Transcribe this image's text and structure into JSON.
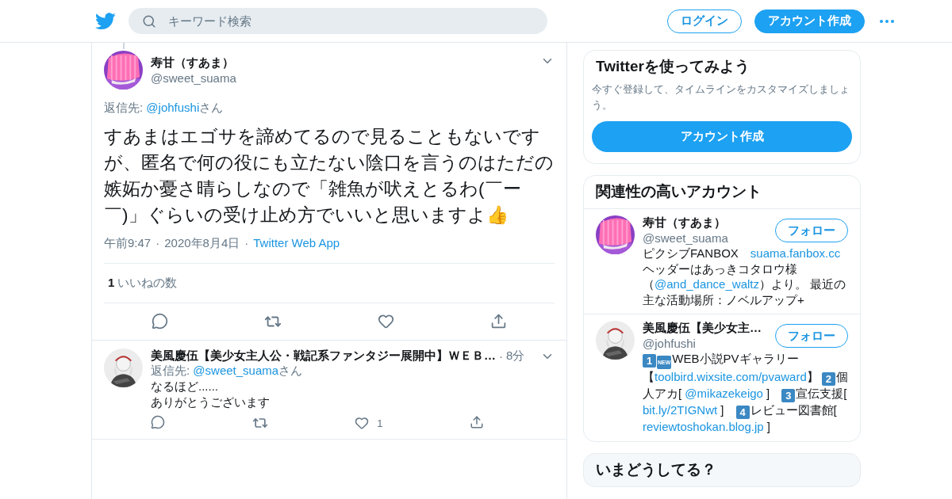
{
  "header": {
    "search": {
      "placeholder": "キーワード検索"
    },
    "login": "ログイン",
    "signup": "アカウント作成"
  },
  "tweet": {
    "name": "寿甘（すあま）",
    "handle": "@sweet_suama",
    "reply": [
      {
        "kind": "plain",
        "text": "返信先: "
      },
      {
        "kind": "link",
        "text": "@johfushi"
      },
      {
        "kind": "plain",
        "text": "さん"
      }
    ],
    "body": "すあまはエゴサを諦めてるので見ることもないですが、匿名で何の役にも立たない陰口を言うのはただの嫉妬か憂さ晴らしなので「雑魚が吠えとるわ(￣ー￣)」ぐらいの受け止め方でいいと思いますよ👍",
    "meta": [
      {
        "kind": "plain",
        "text": "午前9:47"
      },
      {
        "kind": "plain",
        "text": "·"
      },
      {
        "kind": "plain",
        "text": "2020年8月4日"
      },
      {
        "kind": "plain",
        "text": "·"
      },
      {
        "kind": "link",
        "text": "Twitter Web App"
      }
    ],
    "like_count": "1",
    "like_label": "いいねの数"
  },
  "replies": [
    {
      "name": "美風慶伍【美少女主人公・戦記系ファンタジー展開中】ＷＥＢ…",
      "dot": "·",
      "time": "8分",
      "reply": [
        {
          "kind": "plain",
          "text": "返信先: "
        },
        {
          "kind": "link",
          "text": "@sweet_suama"
        },
        {
          "kind": "plain",
          "text": "さん"
        }
      ],
      "lines": [
        "なるほど......",
        "ありがとうございます"
      ],
      "like_count": "1"
    }
  ],
  "signup_card": {
    "title": "Twitterを使ってみよう",
    "text": "今すぐ登録して、タイムラインをカスタマイズしましょう。",
    "button": "アカウント作成"
  },
  "related": {
    "title": "関連性の高いアカウント",
    "accounts": [
      {
        "name": "寿甘（すあま）",
        "handle": "@sweet_suama",
        "button": "フォロー",
        "bio": [
          {
            "kind": "text",
            "text": "ピクシブFANBOX　"
          },
          {
            "kind": "link",
            "text": "suama.fanbox.cc"
          },
          {
            "kind": "text",
            "text": " ヘッダーはあっきコタロウ様（"
          },
          {
            "kind": "link",
            "text": "@and_dance_waltz"
          },
          {
            "kind": "text",
            "text": "）より。 最近の主な活動場所：ノベルアップ+"
          }
        ]
      },
      {
        "name": "美風慶伍【美少女主…",
        "handle": "@johfushi",
        "button": "フォロー",
        "bio": [
          {
            "kind": "badge",
            "text": "1"
          },
          {
            "kind": "badge",
            "text": "NEW"
          },
          {
            "kind": "text",
            "text": "WEB小説PVギャラリー【"
          },
          {
            "kind": "link",
            "text": "toolbird.wixsite.com/pvaward"
          },
          {
            "kind": "text",
            "text": "】 "
          },
          {
            "kind": "badge",
            "text": "2"
          },
          {
            "kind": "text",
            "text": "個人アカ[ "
          },
          {
            "kind": "link",
            "text": "@mikazekeigo"
          },
          {
            "kind": "text",
            "text": " ]　"
          },
          {
            "kind": "badge",
            "text": "3"
          },
          {
            "kind": "text",
            "text": "宣伝支援[ "
          },
          {
            "kind": "link",
            "text": "bit.ly/2TIGNwt"
          },
          {
            "kind": "text",
            "text": " ]　"
          },
          {
            "kind": "badge",
            "text": "4"
          },
          {
            "kind": "text",
            "text": "レビュー図書館[ "
          },
          {
            "kind": "link",
            "text": "reviewtoshokan.blog.jp"
          },
          {
            "kind": "text",
            "text": " ]"
          }
        ]
      }
    ]
  },
  "trends": {
    "title": "いまどうしてる？"
  }
}
